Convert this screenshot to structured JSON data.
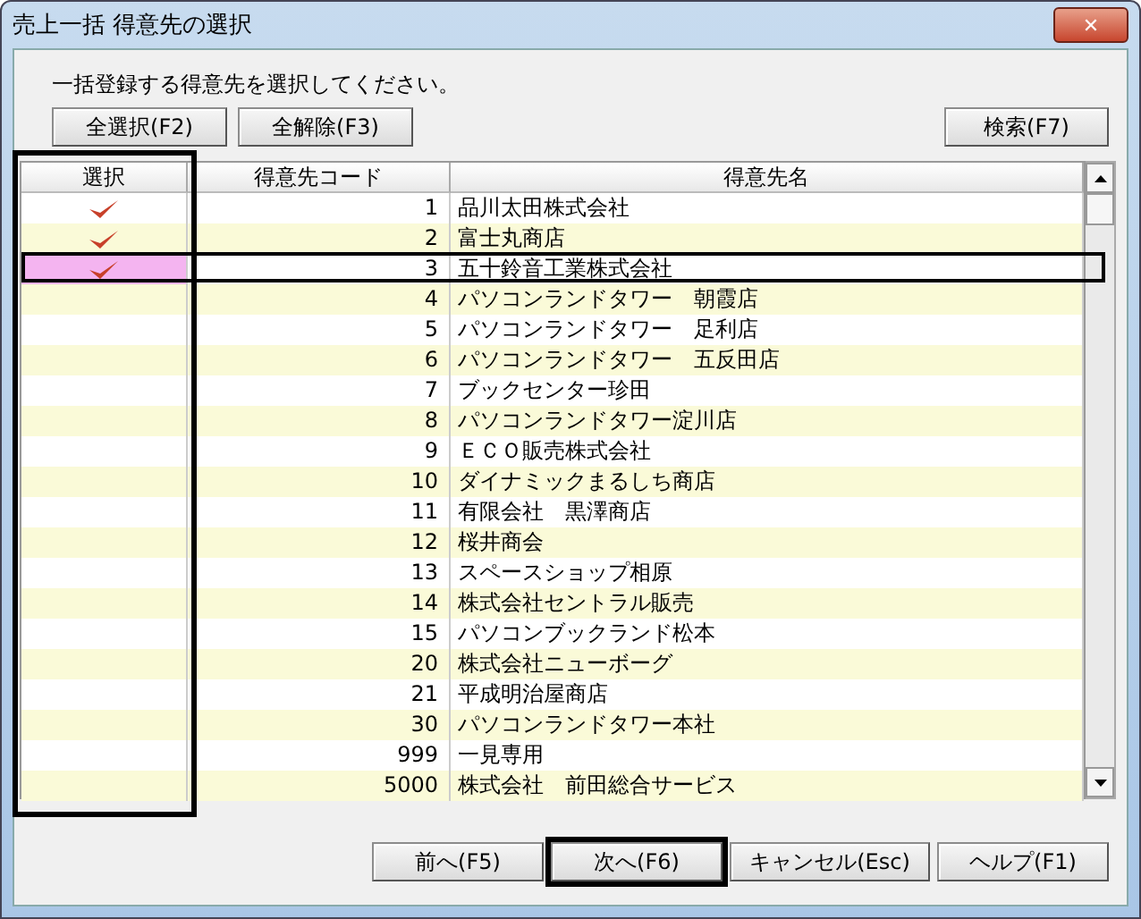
{
  "window": {
    "title": "売上一括 得意先の選択",
    "close_glyph": "✕"
  },
  "instruction": "一括登録する得意先を選択してください。",
  "top_buttons": [
    {
      "label": "全選択(F2)"
    },
    {
      "label": "全解除(F3)"
    }
  ],
  "search_button": {
    "label": "検索(F7)"
  },
  "grid": {
    "select_column_outlined": true,
    "columns": [
      "選択",
      "得意先コード",
      "得意先名"
    ],
    "rows": [
      {
        "code": "1",
        "name": "品川太田株式会社",
        "checked": true,
        "current": false
      },
      {
        "code": "2",
        "name": "富士丸商店",
        "checked": true,
        "current": false
      },
      {
        "code": "3",
        "name": "五十鈴音工業株式会社",
        "checked": true,
        "current": true
      },
      {
        "code": "4",
        "name": "パソコンランドタワー　朝霞店",
        "checked": false,
        "current": false
      },
      {
        "code": "5",
        "name": "パソコンランドタワー　足利店",
        "checked": false,
        "current": false
      },
      {
        "code": "6",
        "name": "パソコンランドタワー　五反田店",
        "checked": false,
        "current": false
      },
      {
        "code": "7",
        "name": "ブックセンター珍田",
        "checked": false,
        "current": false
      },
      {
        "code": "8",
        "name": "パソコンランドタワー淀川店",
        "checked": false,
        "current": false
      },
      {
        "code": "9",
        "name": "ＥＣＯ販売株式会社",
        "checked": false,
        "current": false
      },
      {
        "code": "10",
        "name": "ダイナミックまるしち商店",
        "checked": false,
        "current": false
      },
      {
        "code": "11",
        "name": "有限会社　黒澤商店",
        "checked": false,
        "current": false
      },
      {
        "code": "12",
        "name": "桜井商会",
        "checked": false,
        "current": false
      },
      {
        "code": "13",
        "name": "スペースショップ相原",
        "checked": false,
        "current": false
      },
      {
        "code": "14",
        "name": "株式会社セントラル販売",
        "checked": false,
        "current": false
      },
      {
        "code": "15",
        "name": "パソコンブックランド松本",
        "checked": false,
        "current": false
      },
      {
        "code": "20",
        "name": "株式会社ニューボーグ",
        "checked": false,
        "current": false
      },
      {
        "code": "21",
        "name": "平成明治屋商店",
        "checked": false,
        "current": false
      },
      {
        "code": "30",
        "name": "パソコンランドタワー本社",
        "checked": false,
        "current": false
      },
      {
        "code": "999",
        "name": "一見専用",
        "checked": false,
        "current": false
      },
      {
        "code": "5000",
        "name": "株式会社　前田総合サービス",
        "checked": false,
        "current": false
      }
    ]
  },
  "bottom_buttons": [
    {
      "label": "前へ(F5)",
      "outlined": false
    },
    {
      "label": "次へ(F6)",
      "outlined": true
    },
    {
      "label": "キャンセル(Esc)",
      "outlined": false
    },
    {
      "label": "ヘルプ(F1)",
      "outlined": false
    }
  ]
}
